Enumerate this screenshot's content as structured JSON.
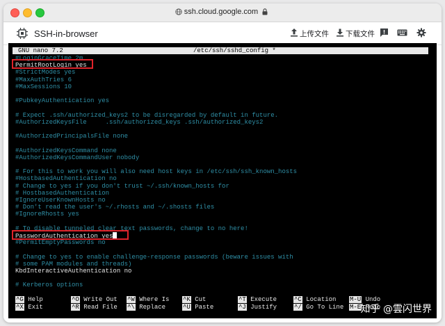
{
  "browser": {
    "url": "ssh.cloud.google.com"
  },
  "app": {
    "title": "SSH-in-browser",
    "upload_label": "上传文件",
    "download_label": "下载文件"
  },
  "nano": {
    "version": "GNU nano 7.2",
    "filename": "/etc/ssh/sshd_config *"
  },
  "lines": [
    {
      "text": "#LoginGraceTime 2m",
      "kind": "comment"
    },
    {
      "text": "PermitRootLogin yes",
      "kind": "plain"
    },
    {
      "text": "#StrictModes yes",
      "kind": "comment"
    },
    {
      "text": "#MaxAuthTries 6",
      "kind": "comment"
    },
    {
      "text": "#MaxSessions 10",
      "kind": "comment"
    },
    {
      "text": "",
      "kind": "comment"
    },
    {
      "text": "#PubkeyAuthentication yes",
      "kind": "comment"
    },
    {
      "text": "",
      "kind": "comment"
    },
    {
      "text": "# Expect .ssh/authorized_keys2 to be disregarded by default in future.",
      "kind": "comment"
    },
    {
      "text": "#AuthorizedKeysFile     .ssh/authorized_keys .ssh/authorized_keys2",
      "kind": "comment"
    },
    {
      "text": "",
      "kind": "comment"
    },
    {
      "text": "#AuthorizedPrincipalsFile none",
      "kind": "comment"
    },
    {
      "text": "",
      "kind": "comment"
    },
    {
      "text": "#AuthorizedKeysCommand none",
      "kind": "comment"
    },
    {
      "text": "#AuthorizedKeysCommandUser nobody",
      "kind": "comment"
    },
    {
      "text": "",
      "kind": "comment"
    },
    {
      "text": "# For this to work you will also need host keys in /etc/ssh/ssh_known_hosts",
      "kind": "comment"
    },
    {
      "text": "#HostbasedAuthentication no",
      "kind": "comment"
    },
    {
      "text": "# Change to yes if you don't trust ~/.ssh/known_hosts for",
      "kind": "comment"
    },
    {
      "text": "# HostbasedAuthentication",
      "kind": "comment"
    },
    {
      "text": "#IgnoreUserKnownHosts no",
      "kind": "comment"
    },
    {
      "text": "# Don't read the user's ~/.rhosts and ~/.shosts files",
      "kind": "comment"
    },
    {
      "text": "#IgnoreRhosts yes",
      "kind": "comment"
    },
    {
      "text": "",
      "kind": "comment"
    },
    {
      "text": "# To disable tunneled clear text passwords, change to no here!",
      "kind": "comment"
    },
    {
      "text": "PasswordAuthentication yes",
      "kind": "plain"
    },
    {
      "text": "#PermitEmptyPasswords no",
      "kind": "comment"
    },
    {
      "text": "",
      "kind": "comment"
    },
    {
      "text": "# Change to yes to enable challenge-response passwords (beware issues with",
      "kind": "comment"
    },
    {
      "text": "# some PAM modules and threads)",
      "kind": "comment"
    },
    {
      "text": "KbdInteractiveAuthentication no",
      "kind": "plain"
    },
    {
      "text": "",
      "kind": "comment"
    },
    {
      "text": "# Kerberos options",
      "kind": "comment"
    }
  ],
  "shortcuts": [
    {
      "key": "^G",
      "label": "Help"
    },
    {
      "key": "^X",
      "label": "Exit"
    },
    {
      "key": "^O",
      "label": "Write Out"
    },
    {
      "key": "^R",
      "label": "Read File"
    },
    {
      "key": "^W",
      "label": "Where Is"
    },
    {
      "key": "^\\",
      "label": "Replace"
    },
    {
      "key": "^K",
      "label": "Cut"
    },
    {
      "key": "^U",
      "label": "Paste"
    },
    {
      "key": "^T",
      "label": "Execute"
    },
    {
      "key": "^J",
      "label": "Justify"
    },
    {
      "key": "^C",
      "label": "Location"
    },
    {
      "key": "^/",
      "label": "Go To Line"
    },
    {
      "key": "M-U",
      "label": "Undo"
    },
    {
      "key": "M-E",
      "label": "Redo"
    }
  ],
  "watermark": "知乎 @雲闪世界",
  "colors": {
    "comment": "#2f8fa6",
    "plain": "#e6e6e6",
    "highlight_box": "#e0232a",
    "terminal_bg": "#000000"
  }
}
